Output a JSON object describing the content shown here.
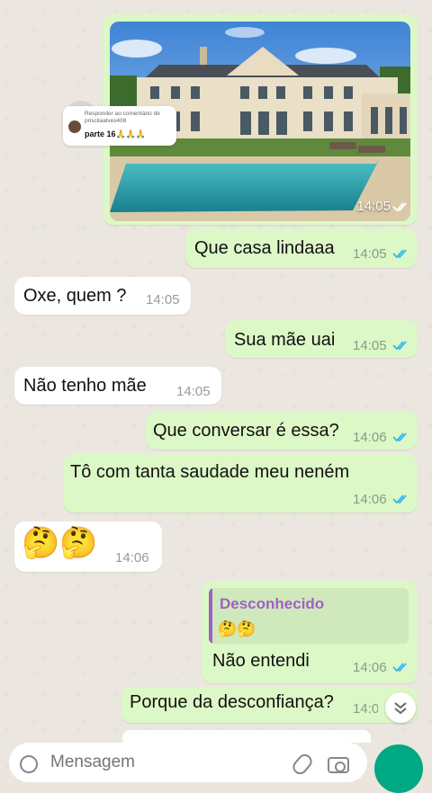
{
  "messages": {
    "image": {
      "time": "14:05"
    },
    "comment": {
      "small_text": "Responder ao comentário de priscilaalves408",
      "main_text": "parte 16🙏🙏🙏"
    },
    "m1": {
      "text": "Que casa lindaaa",
      "time": "14:05"
    },
    "m2": {
      "text": "Oxe, quem ?",
      "time": "14:05"
    },
    "m3": {
      "text": "Sua mãe uai",
      "time": "14:05"
    },
    "m4": {
      "text": "Não tenho mãe",
      "time": "14:05"
    },
    "m5": {
      "text": "Que conversar é essa?",
      "time": "14:06"
    },
    "m6": {
      "text": "Tô com tanta saudade meu neném",
      "time": "14:06"
    },
    "m7": {
      "text": "🤔🤔",
      "time": "14:06"
    },
    "m8": {
      "quote_name": "Desconhecido",
      "quote_text": "🤔🤔",
      "text": "Não entendi",
      "time": "14:06"
    },
    "m9": {
      "text": "Porque da desconfiança?",
      "time": "14:07"
    }
  },
  "input": {
    "placeholder": "Mensagem"
  },
  "colors": {
    "outgoing": "#dcf8c6",
    "incoming": "#ffffff",
    "read_ticks": "#34b7f1",
    "quote_accent": "#a25fc4",
    "send_button": "#00a884"
  }
}
